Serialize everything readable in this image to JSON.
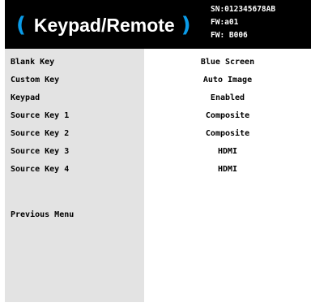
{
  "header": {
    "title": "Keypad/Remote",
    "serial": "SN:012345678AB",
    "fw1": "FW:a01",
    "fw2": "FW: B006"
  },
  "menu": {
    "items": [
      {
        "label": "Blank Key",
        "value": "Blue Screen"
      },
      {
        "label": "Custom Key",
        "value": "Auto Image"
      },
      {
        "label": "Keypad",
        "value": "Enabled"
      },
      {
        "label": "Source Key 1",
        "value": "Composite"
      },
      {
        "label": "Source Key 2",
        "value": "Composite"
      },
      {
        "label": "Source Key 3",
        "value": "HDMI"
      },
      {
        "label": "Source Key 4",
        "value": "HDMI"
      }
    ],
    "previous": "Previous Menu"
  },
  "colors": {
    "accent": "#0a9be8",
    "header_bg": "#000000",
    "label_panel": "#e3e3e3",
    "value_panel": "#ffffff"
  }
}
